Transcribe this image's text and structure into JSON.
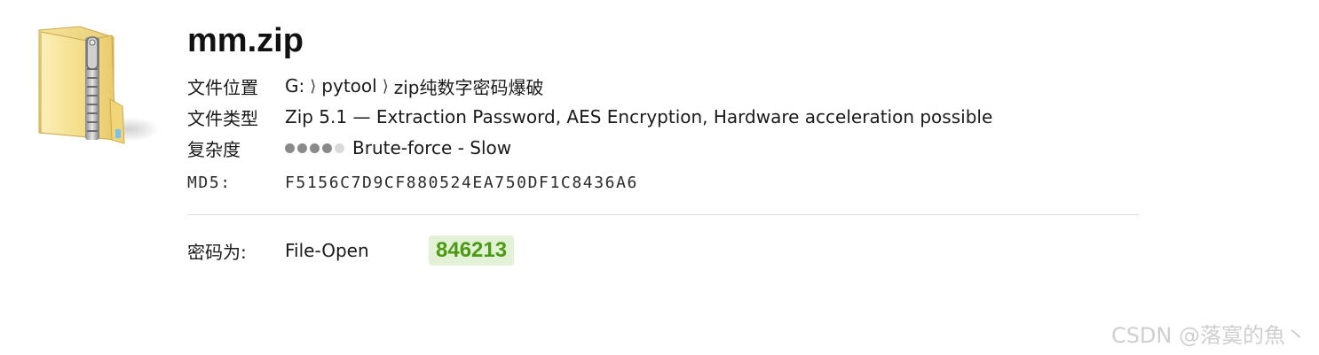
{
  "file": {
    "name": "mm.zip",
    "icon": "zip-folder-icon"
  },
  "location": {
    "label": "文件位置",
    "crumbs": [
      "G:",
      "pytool",
      "zip纯数字密码爆破"
    ],
    "separator": "⟩"
  },
  "file_type": {
    "label": "文件类型",
    "value": "Zip 5.1 — Extraction Password, AES Encryption, Hardware acceleration possible"
  },
  "complexity": {
    "label": "复杂度",
    "level": 4,
    "max": 5,
    "text": "Brute-force - Slow"
  },
  "md5": {
    "label": "MD5:",
    "value": "F5156C7D9CF880524EA750DF1C8436A6"
  },
  "result": {
    "label": "密码为:",
    "attack_mode": "File-Open",
    "password": "846213",
    "badge_color": "#e3f1d6",
    "password_color": "#4a9a12"
  },
  "watermark": "CSDN @落寞的魚丶"
}
